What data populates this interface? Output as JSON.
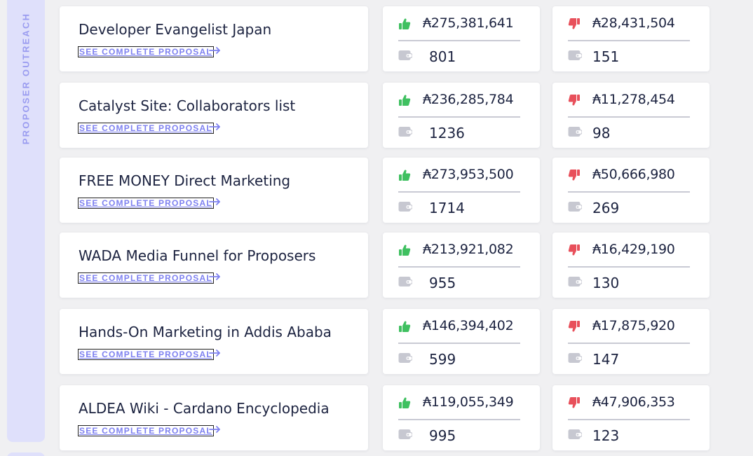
{
  "sidebar": {
    "label": "PROPOSER OUTREACH"
  },
  "link_label": "SEE COMPLETE PROPOSAL",
  "colors": {
    "yes": "#3fc060",
    "no": "#e8505b",
    "accent": "#7d80f0"
  },
  "icons": {
    "yes": "thumbs-up-icon",
    "no": "thumbs-down-icon",
    "wallet": "wallet-icon",
    "arrow": "arrow-right-icon"
  },
  "proposals": [
    {
      "title": "Developer Evangelist Japan",
      "yes_amount": "₳275,381,641",
      "yes_count": "801",
      "no_amount": "₳28,431,504",
      "no_count": "151"
    },
    {
      "title": "Catalyst Site: Collaborators list",
      "yes_amount": "₳236,285,784",
      "yes_count": "1236",
      "no_amount": "₳11,278,454",
      "no_count": "98"
    },
    {
      "title": "FREE MONEY Direct Marketing",
      "yes_amount": "₳273,953,500",
      "yes_count": "1714",
      "no_amount": "₳50,666,980",
      "no_count": "269"
    },
    {
      "title": "WADA Media Funnel for Proposers",
      "yes_amount": "₳213,921,082",
      "yes_count": "955",
      "no_amount": "₳16,429,190",
      "no_count": "130"
    },
    {
      "title": "Hands-On Marketing in Addis Ababa",
      "yes_amount": "₳146,394,402",
      "yes_count": "599",
      "no_amount": "₳17,875,920",
      "no_count": "147"
    },
    {
      "title": "ALDEA Wiki - Cardano Encyclopedia",
      "yes_amount": "₳119,055,349",
      "yes_count": "995",
      "no_amount": "₳47,906,353",
      "no_count": "123"
    }
  ]
}
